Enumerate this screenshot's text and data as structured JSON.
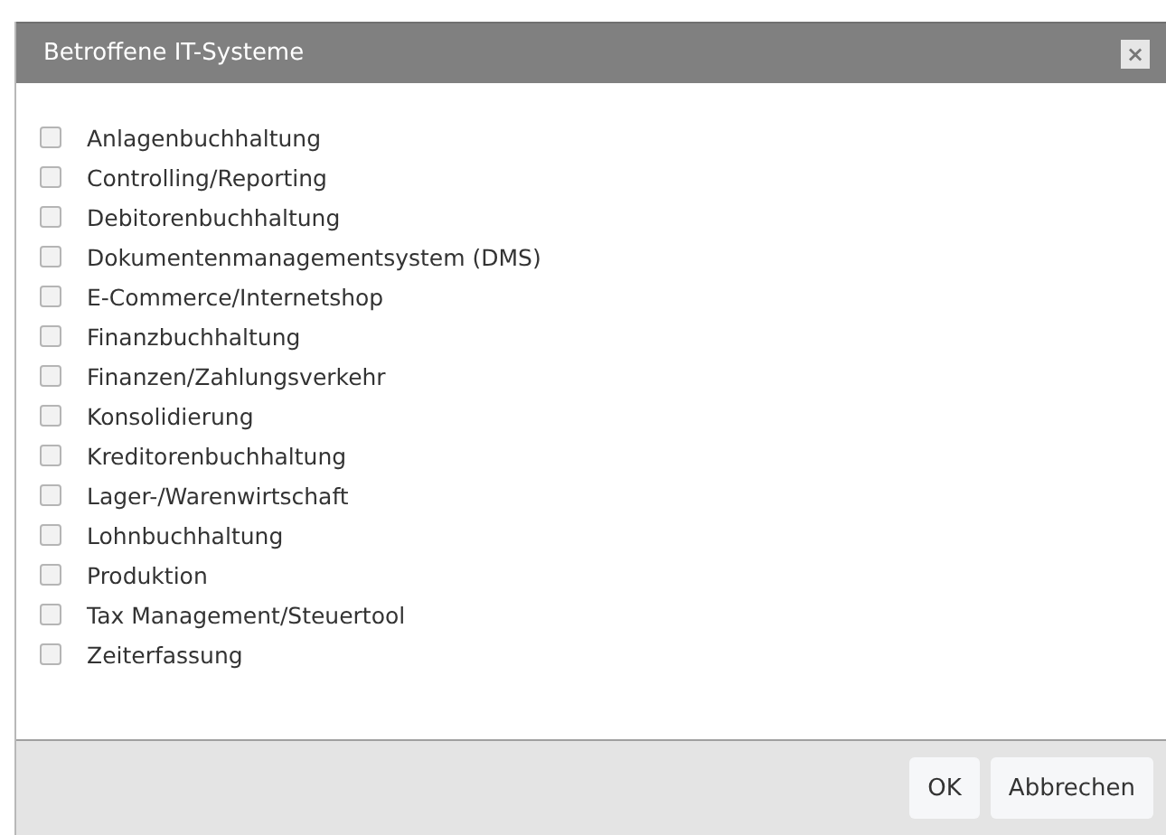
{
  "dialog": {
    "title": "Betroffene IT-Systeme",
    "close": "×"
  },
  "options": [
    {
      "label": "Anlagenbuchhaltung",
      "checked": false
    },
    {
      "label": "Controlling/Reporting",
      "checked": false
    },
    {
      "label": "Debitorenbuchhaltung",
      "checked": false
    },
    {
      "label": "Dokumentenmanagementsystem (DMS)",
      "checked": false
    },
    {
      "label": "E-Commerce/Internetshop",
      "checked": false
    },
    {
      "label": "Finanzbuchhaltung",
      "checked": false
    },
    {
      "label": "Finanzen/Zahlungsverkehr",
      "checked": false
    },
    {
      "label": "Konsolidierung",
      "checked": false
    },
    {
      "label": "Kreditorenbuchhaltung",
      "checked": false
    },
    {
      "label": "Lager-/Warenwirtschaft",
      "checked": false
    },
    {
      "label": "Lohnbuchhaltung",
      "checked": false
    },
    {
      "label": "Produktion",
      "checked": false
    },
    {
      "label": "Tax Management/Steuertool",
      "checked": false
    },
    {
      "label": "Zeiterfassung",
      "checked": false
    }
  ],
  "buttons": [
    "OK",
    "Abbrechen"
  ]
}
